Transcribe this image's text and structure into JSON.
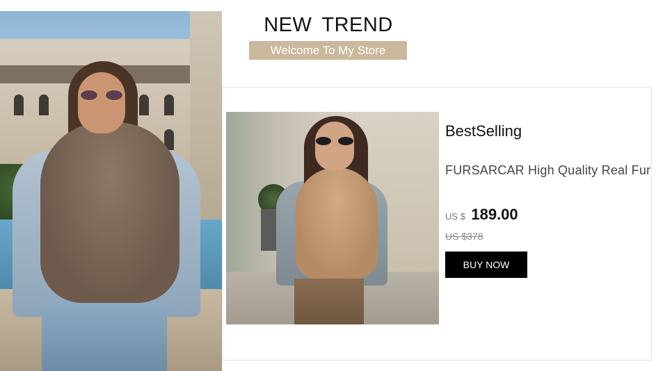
{
  "header": {
    "title": "NEW  TREND",
    "welcome": "Welcome To My Store"
  },
  "hero_image": {
    "icon": "fashion-model-photo"
  },
  "product": {
    "badge": "BestSelling",
    "name": "FURSARCAR High Quality Real Fur",
    "currency": "US $",
    "price": "189.00",
    "old_price": "US $378",
    "buy_label": "BUY NOW",
    "image_icon": "product-photo"
  },
  "colors": {
    "welcome_bg": "#c9b89c",
    "buy_bg": "#000000"
  }
}
